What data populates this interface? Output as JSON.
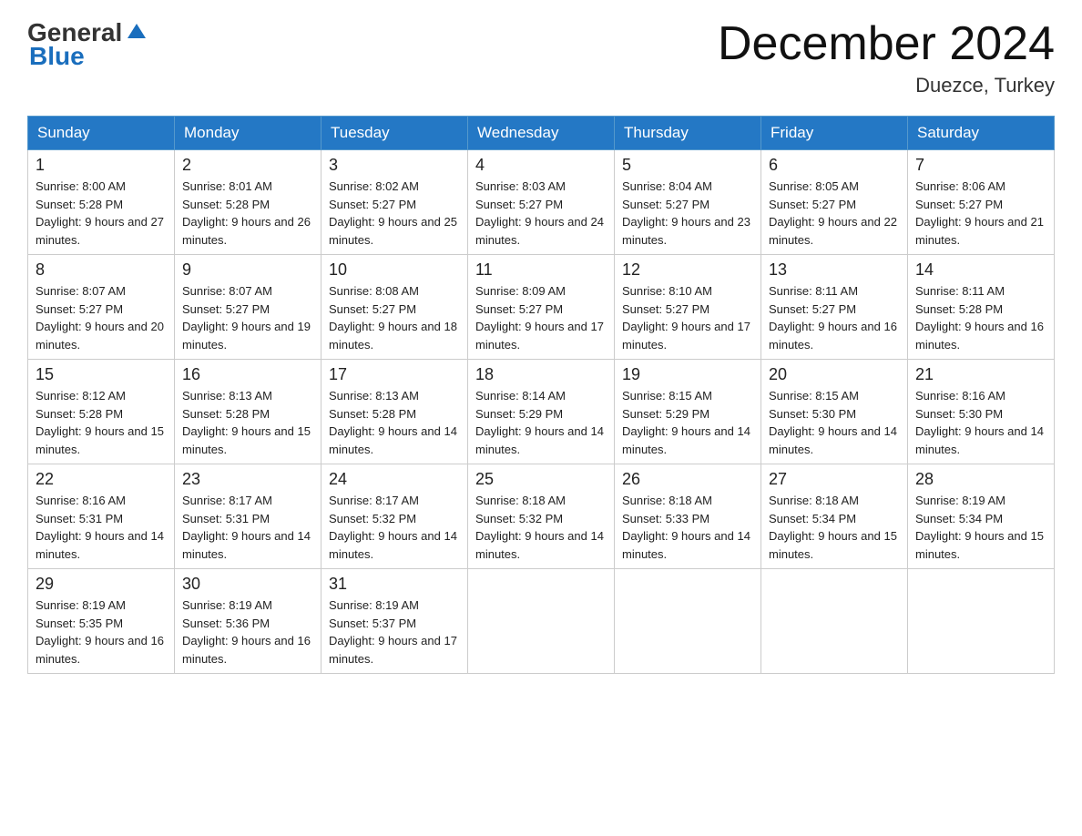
{
  "header": {
    "logo_general": "General",
    "logo_blue": "Blue",
    "main_title": "December 2024",
    "subtitle": "Duezce, Turkey"
  },
  "calendar": {
    "days_of_week": [
      "Sunday",
      "Monday",
      "Tuesday",
      "Wednesday",
      "Thursday",
      "Friday",
      "Saturday"
    ],
    "weeks": [
      [
        {
          "day": "1",
          "sunrise": "Sunrise: 8:00 AM",
          "sunset": "Sunset: 5:28 PM",
          "daylight": "Daylight: 9 hours and 27 minutes."
        },
        {
          "day": "2",
          "sunrise": "Sunrise: 8:01 AM",
          "sunset": "Sunset: 5:28 PM",
          "daylight": "Daylight: 9 hours and 26 minutes."
        },
        {
          "day": "3",
          "sunrise": "Sunrise: 8:02 AM",
          "sunset": "Sunset: 5:27 PM",
          "daylight": "Daylight: 9 hours and 25 minutes."
        },
        {
          "day": "4",
          "sunrise": "Sunrise: 8:03 AM",
          "sunset": "Sunset: 5:27 PM",
          "daylight": "Daylight: 9 hours and 24 minutes."
        },
        {
          "day": "5",
          "sunrise": "Sunrise: 8:04 AM",
          "sunset": "Sunset: 5:27 PM",
          "daylight": "Daylight: 9 hours and 23 minutes."
        },
        {
          "day": "6",
          "sunrise": "Sunrise: 8:05 AM",
          "sunset": "Sunset: 5:27 PM",
          "daylight": "Daylight: 9 hours and 22 minutes."
        },
        {
          "day": "7",
          "sunrise": "Sunrise: 8:06 AM",
          "sunset": "Sunset: 5:27 PM",
          "daylight": "Daylight: 9 hours and 21 minutes."
        }
      ],
      [
        {
          "day": "8",
          "sunrise": "Sunrise: 8:07 AM",
          "sunset": "Sunset: 5:27 PM",
          "daylight": "Daylight: 9 hours and 20 minutes."
        },
        {
          "day": "9",
          "sunrise": "Sunrise: 8:07 AM",
          "sunset": "Sunset: 5:27 PM",
          "daylight": "Daylight: 9 hours and 19 minutes."
        },
        {
          "day": "10",
          "sunrise": "Sunrise: 8:08 AM",
          "sunset": "Sunset: 5:27 PM",
          "daylight": "Daylight: 9 hours and 18 minutes."
        },
        {
          "day": "11",
          "sunrise": "Sunrise: 8:09 AM",
          "sunset": "Sunset: 5:27 PM",
          "daylight": "Daylight: 9 hours and 17 minutes."
        },
        {
          "day": "12",
          "sunrise": "Sunrise: 8:10 AM",
          "sunset": "Sunset: 5:27 PM",
          "daylight": "Daylight: 9 hours and 17 minutes."
        },
        {
          "day": "13",
          "sunrise": "Sunrise: 8:11 AM",
          "sunset": "Sunset: 5:27 PM",
          "daylight": "Daylight: 9 hours and 16 minutes."
        },
        {
          "day": "14",
          "sunrise": "Sunrise: 8:11 AM",
          "sunset": "Sunset: 5:28 PM",
          "daylight": "Daylight: 9 hours and 16 minutes."
        }
      ],
      [
        {
          "day": "15",
          "sunrise": "Sunrise: 8:12 AM",
          "sunset": "Sunset: 5:28 PM",
          "daylight": "Daylight: 9 hours and 15 minutes."
        },
        {
          "day": "16",
          "sunrise": "Sunrise: 8:13 AM",
          "sunset": "Sunset: 5:28 PM",
          "daylight": "Daylight: 9 hours and 15 minutes."
        },
        {
          "day": "17",
          "sunrise": "Sunrise: 8:13 AM",
          "sunset": "Sunset: 5:28 PM",
          "daylight": "Daylight: 9 hours and 14 minutes."
        },
        {
          "day": "18",
          "sunrise": "Sunrise: 8:14 AM",
          "sunset": "Sunset: 5:29 PM",
          "daylight": "Daylight: 9 hours and 14 minutes."
        },
        {
          "day": "19",
          "sunrise": "Sunrise: 8:15 AM",
          "sunset": "Sunset: 5:29 PM",
          "daylight": "Daylight: 9 hours and 14 minutes."
        },
        {
          "day": "20",
          "sunrise": "Sunrise: 8:15 AM",
          "sunset": "Sunset: 5:30 PM",
          "daylight": "Daylight: 9 hours and 14 minutes."
        },
        {
          "day": "21",
          "sunrise": "Sunrise: 8:16 AM",
          "sunset": "Sunset: 5:30 PM",
          "daylight": "Daylight: 9 hours and 14 minutes."
        }
      ],
      [
        {
          "day": "22",
          "sunrise": "Sunrise: 8:16 AM",
          "sunset": "Sunset: 5:31 PM",
          "daylight": "Daylight: 9 hours and 14 minutes."
        },
        {
          "day": "23",
          "sunrise": "Sunrise: 8:17 AM",
          "sunset": "Sunset: 5:31 PM",
          "daylight": "Daylight: 9 hours and 14 minutes."
        },
        {
          "day": "24",
          "sunrise": "Sunrise: 8:17 AM",
          "sunset": "Sunset: 5:32 PM",
          "daylight": "Daylight: 9 hours and 14 minutes."
        },
        {
          "day": "25",
          "sunrise": "Sunrise: 8:18 AM",
          "sunset": "Sunset: 5:32 PM",
          "daylight": "Daylight: 9 hours and 14 minutes."
        },
        {
          "day": "26",
          "sunrise": "Sunrise: 8:18 AM",
          "sunset": "Sunset: 5:33 PM",
          "daylight": "Daylight: 9 hours and 14 minutes."
        },
        {
          "day": "27",
          "sunrise": "Sunrise: 8:18 AM",
          "sunset": "Sunset: 5:34 PM",
          "daylight": "Daylight: 9 hours and 15 minutes."
        },
        {
          "day": "28",
          "sunrise": "Sunrise: 8:19 AM",
          "sunset": "Sunset: 5:34 PM",
          "daylight": "Daylight: 9 hours and 15 minutes."
        }
      ],
      [
        {
          "day": "29",
          "sunrise": "Sunrise: 8:19 AM",
          "sunset": "Sunset: 5:35 PM",
          "daylight": "Daylight: 9 hours and 16 minutes."
        },
        {
          "day": "30",
          "sunrise": "Sunrise: 8:19 AM",
          "sunset": "Sunset: 5:36 PM",
          "daylight": "Daylight: 9 hours and 16 minutes."
        },
        {
          "day": "31",
          "sunrise": "Sunrise: 8:19 AM",
          "sunset": "Sunset: 5:37 PM",
          "daylight": "Daylight: 9 hours and 17 minutes."
        },
        null,
        null,
        null,
        null
      ]
    ]
  }
}
